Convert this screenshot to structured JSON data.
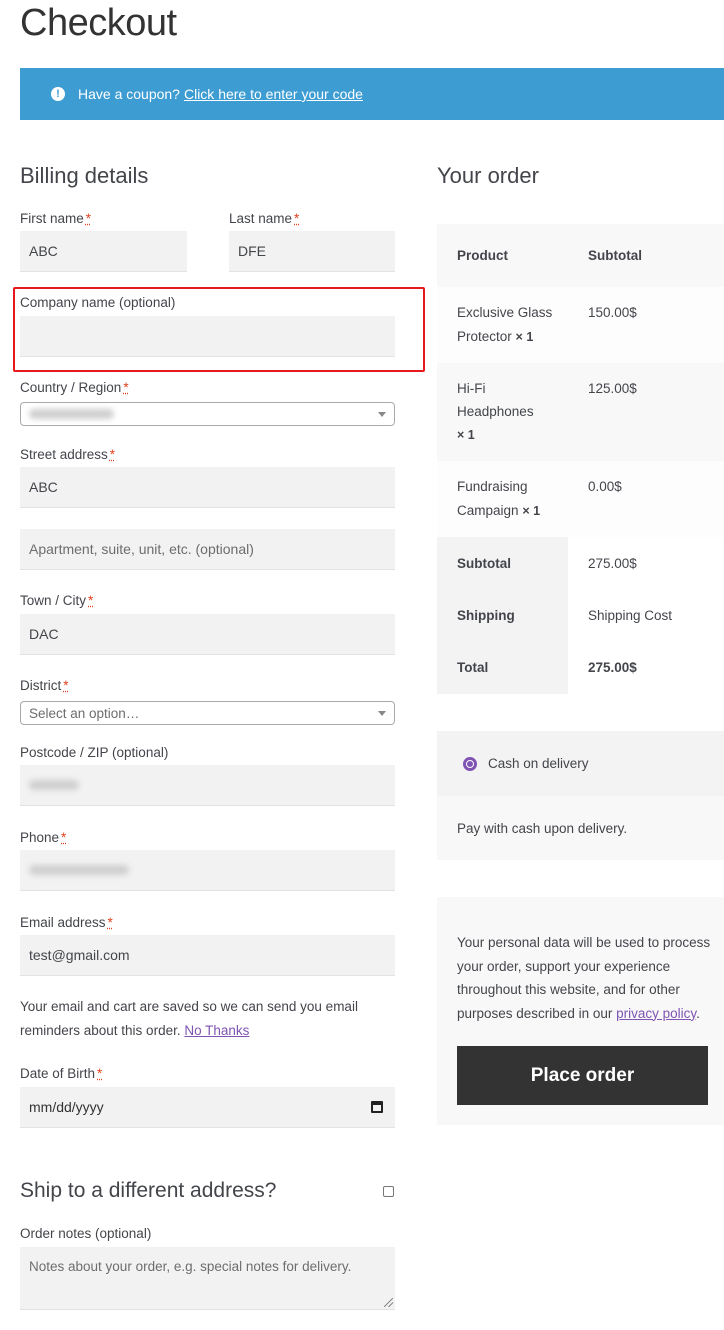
{
  "page": {
    "title": "Checkout"
  },
  "coupon": {
    "text": "Have a coupon?",
    "link": "Click here to enter your code"
  },
  "billing": {
    "title": "Billing details",
    "required_mark": "*",
    "first_name": {
      "label": "First name",
      "value": "ABC"
    },
    "last_name": {
      "label": "Last name",
      "value": "DFE"
    },
    "company": {
      "label": "Company name (optional)",
      "value": ""
    },
    "country": {
      "label": "Country / Region"
    },
    "street": {
      "label": "Street address",
      "value": "ABC",
      "placeholder2": "Apartment, suite, unit, etc. (optional)"
    },
    "city": {
      "label": "Town / City",
      "value": "DAC"
    },
    "district": {
      "label": "District",
      "placeholder": "Select an option…"
    },
    "postcode": {
      "label": "Postcode / ZIP (optional)"
    },
    "phone": {
      "label": "Phone"
    },
    "email": {
      "label": "Email address",
      "value": "test@gmail.com"
    },
    "email_note": "Your email and cart are saved so we can send you email reminders about this order.",
    "email_note_link": "No Thanks",
    "dob": {
      "label": "Date of Birth",
      "placeholder": "mm/dd/yyyy"
    }
  },
  "shipping": {
    "title": "Ship to a different address?"
  },
  "order_notes": {
    "label": "Order notes (optional)",
    "placeholder": "Notes about your order, e.g. special notes for delivery."
  },
  "order": {
    "title": "Your order",
    "col_product": "Product",
    "col_subtotal": "Subtotal",
    "items": [
      {
        "name_line1": "Exclusive Glass",
        "name_line2": "Protector",
        "qty": "× 1",
        "price": "150.00$"
      },
      {
        "name_line1": "Hi-Fi",
        "name_line2": "Headphones",
        "qty": "× 1",
        "price": "125.00$"
      },
      {
        "name_line1": "Fundraising",
        "name_line2": "Campaign",
        "qty": "× 1",
        "price": "0.00$"
      }
    ],
    "subtotal_label": "Subtotal",
    "subtotal_value": "275.00$",
    "shipping_label": "Shipping",
    "shipping_value": "Shipping Cost",
    "total_label": "Total",
    "total_value": "275.00$"
  },
  "payment": {
    "method": "Cash on delivery",
    "description": "Pay with cash upon delivery."
  },
  "privacy": {
    "text": "Your personal data will be used to process your order, support your experience throughout this website, and for other purposes described in our",
    "link": "privacy policy",
    "period": "."
  },
  "place_order": "Place order",
  "colors": {
    "accent": "#7f54b3",
    "banner": "#3d9cd2",
    "highlight": "#e8191c",
    "button": "#333333"
  }
}
